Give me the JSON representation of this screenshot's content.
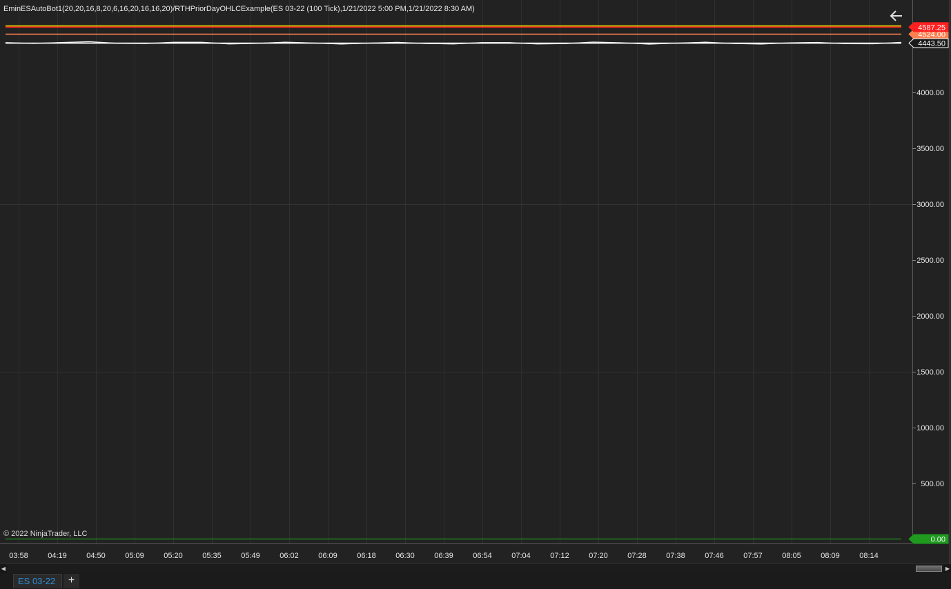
{
  "chart_title": "EminESAutoBot1(20,20,16,8,20,6,16,20,16,16,20)/RTHPriorDayOHLCExample(ES 03-22 (100 Tick),1/21/2022 5:00 PM,1/21/2022 8:30 AM)",
  "copyright": "© 2022 NinjaTrader, LLC",
  "tab_label": "ES 03-22",
  "add_tab_symbol": "+",
  "colors": {
    "background": "#222222",
    "grid": "#303030",
    "price_line": "#ffffff",
    "zero_line": "#1f9a1f",
    "level_high": "#ff2020",
    "level_open": "#ff7f50",
    "level_yellow": "#e6d400",
    "tab_text": "#2f8fd8"
  },
  "chart_data": {
    "type": "line",
    "title": "EminESAutoBot1(20,20,16,8,20,6,16,20,16,16,20)/RTHPriorDayOHLCExample(ES 03-22 (100 Tick),1/21/2022 5:00 PM,1/21/2022 8:30 AM)",
    "x_tick_labels": [
      "03:58",
      "04:19",
      "04:50",
      "05:09",
      "05:20",
      "05:35",
      "05:49",
      "06:02",
      "06:09",
      "06:18",
      "06:30",
      "06:39",
      "06:54",
      "07:04",
      "07:12",
      "07:20",
      "07:28",
      "07:38",
      "07:46",
      "07:57",
      "08:05",
      "08:09",
      "08:14"
    ],
    "y_ticks": [
      4000,
      3500,
      3000,
      2500,
      2000,
      1500,
      1000,
      500
    ],
    "y_tick_labels": [
      "4000.00",
      "3500.00",
      "3000.00",
      "2500.00",
      "2000.00",
      "1500.00",
      "1000.00",
      "500.00"
    ],
    "ylim": [
      -40,
      4830
    ],
    "grid": true,
    "series": [
      {
        "values": [
          4448,
          4449,
          4447,
          4448,
          4446,
          4447,
          4445,
          4446,
          4444,
          4445,
          4444,
          4443,
          4444,
          4443,
          4442,
          4443,
          4444,
          4443,
          4442,
          4443,
          4444,
          4445,
          4444,
          4443,
          4444,
          4443,
          4442,
          4443,
          4442,
          4443,
          4444,
          4443,
          4443.5
        ]
      }
    ],
    "levels": [
      {
        "value": 4598,
        "color": "#e6d400"
      },
      {
        "value": 4587.25,
        "label": "4587.25",
        "color": "#ff2020"
      },
      {
        "value": 4524,
        "label": "4524.00",
        "color": "#ff7f50"
      },
      {
        "value": 4443.5,
        "label": "4443.50",
        "color": "#ffffff"
      },
      {
        "value": 0,
        "label": "0.00",
        "color": "#1f9a1f"
      }
    ]
  }
}
